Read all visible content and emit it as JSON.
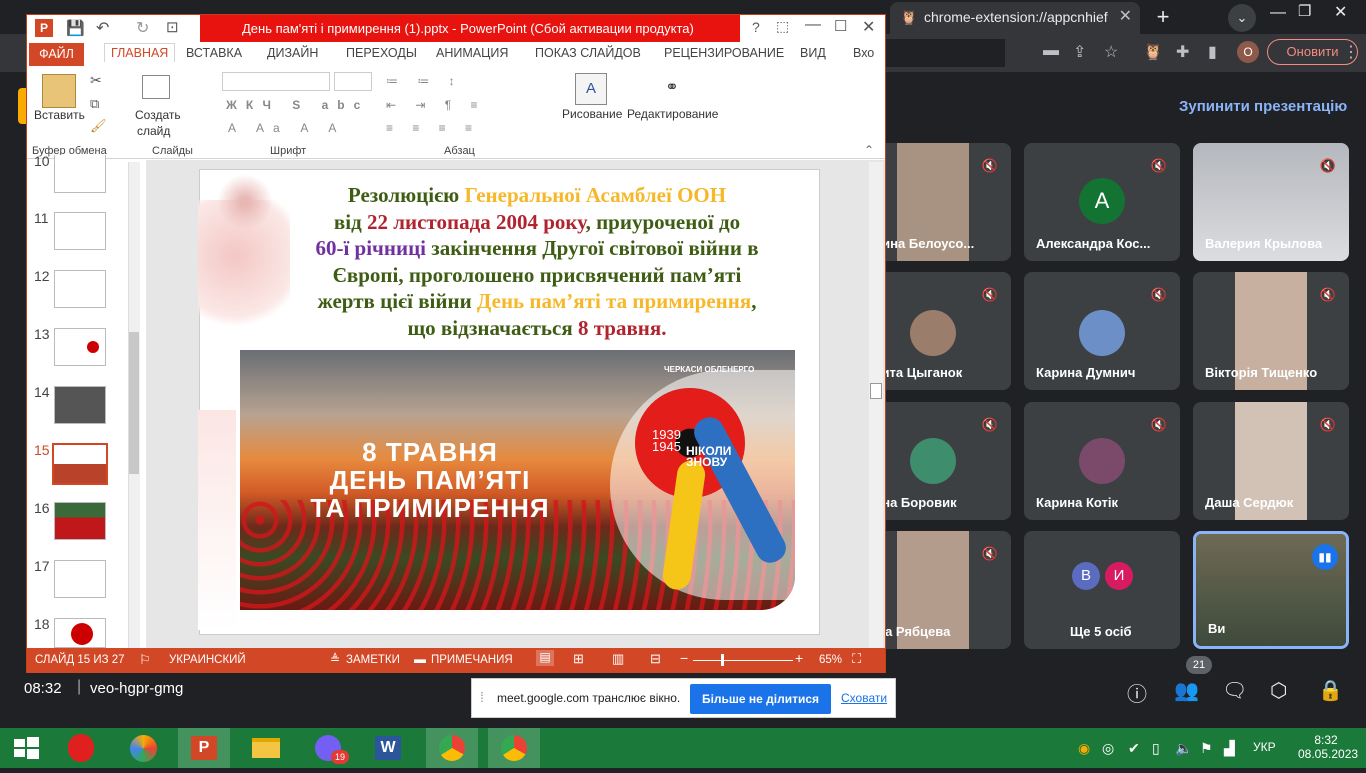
{
  "browser": {
    "tabs": [
      {
        "label": ""
      },
      {
        "label": "chrome-extension://appcnhief"
      }
    ],
    "update_label": "Оновити",
    "profile": "О"
  },
  "meet": {
    "stop_presenting": "Зупинити презентацію",
    "participants": [
      {
        "name": "арина Белоусо...",
        "initial": ""
      },
      {
        "name": "Александра Кос...",
        "initial": "A",
        "color": "#137333"
      },
      {
        "name": "Валерия Крылова",
        "initial": ""
      },
      {
        "name": "икита Цыганок",
        "initial": ""
      },
      {
        "name": "Карина Думнич",
        "initial": ""
      },
      {
        "name": "Вікторія Тищенко",
        "initial": ""
      },
      {
        "name": "иана Боровик",
        "initial": ""
      },
      {
        "name": "Карина Котік",
        "initial": ""
      },
      {
        "name": "Даша Сердюк",
        "initial": ""
      },
      {
        "name": "аша Рябцева",
        "initial": ""
      },
      {
        "name": "Ще 5 осіб",
        "initial": "В И"
      },
      {
        "name": "Ви",
        "initial": ""
      }
    ],
    "more_initials": [
      "В",
      "И"
    ],
    "clock": "08:32",
    "code": "veo-hgpr-gmg",
    "people_count": "21",
    "share_text": "meet.google.com транслює вікно.",
    "stop_share": "Більше не ділитися",
    "hide": "Сховати"
  },
  "ppt": {
    "title": "День пам'яті і примирення (1).pptx - PowerPoint (Сбой активации продукта)",
    "tabs": [
      "ФАЙЛ",
      "ГЛАВНАЯ",
      "ВСТАВКА",
      "ДИЗАЙН",
      "ПЕРЕХОДЫ",
      "АНИМАЦИЯ",
      "ПОКАЗ СЛАЙДОВ",
      "РЕЦЕНЗИРОВАНИЕ",
      "ВИД",
      "Вхо"
    ],
    "ribbon": {
      "paste": "Вставить",
      "create_slide_1": "Создать",
      "create_slide_2": "слайд",
      "drawing": "Рисование",
      "editing": "Редактирование",
      "groups": [
        "Буфер обмена",
        "Слайды",
        "Шрифт",
        "Абзац"
      ]
    },
    "thumbnails": [
      "10",
      "11",
      "12",
      "13",
      "14",
      "15",
      "16",
      "17",
      "18"
    ],
    "slide": {
      "l1a": "Резолюцією ",
      "l1b": "Генеральної Асамблеї ООН",
      "l2a": "від ",
      "l2b": "22 листопада 2004 року",
      "l2c": ", приуроченої до",
      "l3a": "60-ї річниці",
      "l3b": " закінчення Другої світової війни в",
      "l4": "Європі, проголошено присвячений пам’яті",
      "l5a": "жертв цієї війни ",
      "l5b": "День пам’яті та примирення",
      "l5c": ",",
      "l6a": "що відзначається ",
      "l6b": "8 травня.",
      "banner_l1": "8 ТРАВНЯ",
      "banner_l2": "ДЕНЬ ПАМ’ЯТІ",
      "banner_l3": "ТА ПРИМИРЕННЯ",
      "brand": "ЧЕРКАСИ ОБЛЕНЕРГО",
      "years_1": "1939",
      "years_2": "1945",
      "never_1": "НІКОЛИ",
      "never_2": "ЗНОВУ"
    },
    "status": {
      "slide": "СЛАЙД 15 ИЗ 27",
      "lang": "УКРАИНСКИЙ",
      "notes": "ЗАМЕТКИ",
      "comments": "ПРИМЕЧАНИЯ",
      "zoom": "65%"
    }
  },
  "taskbar": {
    "lang": "УКР",
    "time": "8:32",
    "date": "08.05.2023",
    "viber_badge": "19"
  }
}
